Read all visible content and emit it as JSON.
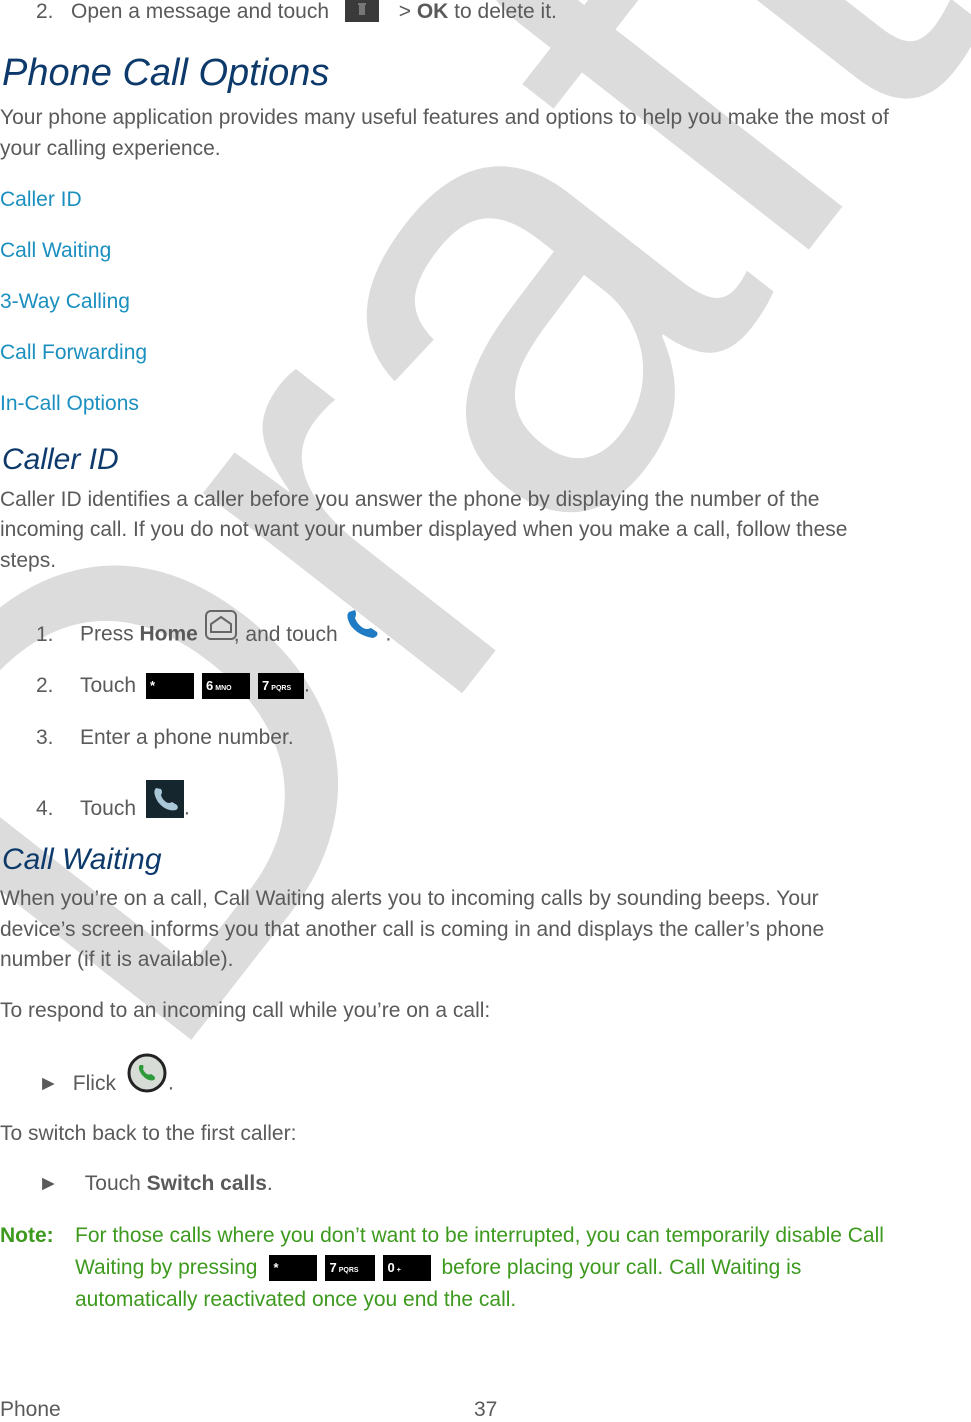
{
  "top_step": {
    "num": "2.",
    "pre": "Open a message and touch",
    "post_a": " > ",
    "ok": "OK",
    "post_b": " to delete it.",
    "icon": "trash-icon"
  },
  "title": "Phone Call Options",
  "intro": [
    "Your phone application provides many useful features and options to help you make the most of",
    "your calling experience."
  ],
  "links": [
    "Caller ID",
    "Call Waiting",
    "3-Way Calling",
    "Call Forwarding",
    "In-Call Options"
  ],
  "caller_id": {
    "heading": "Caller ID",
    "body": [
      "Caller ID identifies a caller before you answer the phone by displaying the number of the",
      "incoming call. If you do not want your number displayed when you make a call, follow these",
      "steps."
    ],
    "steps": [
      {
        "num": "1.",
        "a": "Press ",
        "bold": "Home",
        "b": ", and touch",
        "c": ".",
        "icons": [
          "home-icon",
          "phone-icon"
        ]
      },
      {
        "num": "2.",
        "a": "Touch",
        "keys": [
          {
            "main": "*",
            "sub": ""
          },
          {
            "main": "6",
            "sub": "MNO"
          },
          {
            "main": "7",
            "sub": "PQRS"
          }
        ],
        "c": "."
      },
      {
        "num": "3.",
        "a": "Enter a phone number."
      },
      {
        "num": "4.",
        "a": "Touch",
        "c": ".",
        "icons": [
          "call-button-icon"
        ]
      }
    ]
  },
  "call_waiting": {
    "heading": "Call Waiting",
    "body": [
      "When you’re on a call, Call Waiting alerts you to incoming calls by sounding beeps. Your",
      "device’s screen informs you that another call is coming in and displays the caller’s phone",
      "number (if it is available)."
    ],
    "respond_intro": "To respond to an incoming call while you’re on a call:",
    "bullet1": {
      "marker": "►",
      "a": "Flick",
      "c": "."
    },
    "switch_intro": "To switch back to the first caller:",
    "bullet2": {
      "marker": "►",
      "a": "Touch ",
      "bold": "Switch calls",
      "c": "."
    }
  },
  "note": {
    "label": "Note:",
    "line1": "For those calls where you don’t want to be interrupted, you can temporarily disable Call",
    "line2a": "Waiting by pressing",
    "keys": [
      {
        "main": "*",
        "sub": ""
      },
      {
        "main": "7",
        "sub": "PQRS"
      },
      {
        "main": "0",
        "sub": "+"
      }
    ],
    "line2b": "before placing your call. Call Waiting is",
    "line3": "automatically reactivated once you end the call."
  },
  "footer": {
    "section": "Phone",
    "page": "37"
  },
  "watermark": "Draft",
  "colors": {
    "heading": "#0d3a6b",
    "link": "#1b8fbf",
    "note": "#3d9a1f",
    "body": "#5a5a5a",
    "watermark": "#d9d9d9"
  }
}
